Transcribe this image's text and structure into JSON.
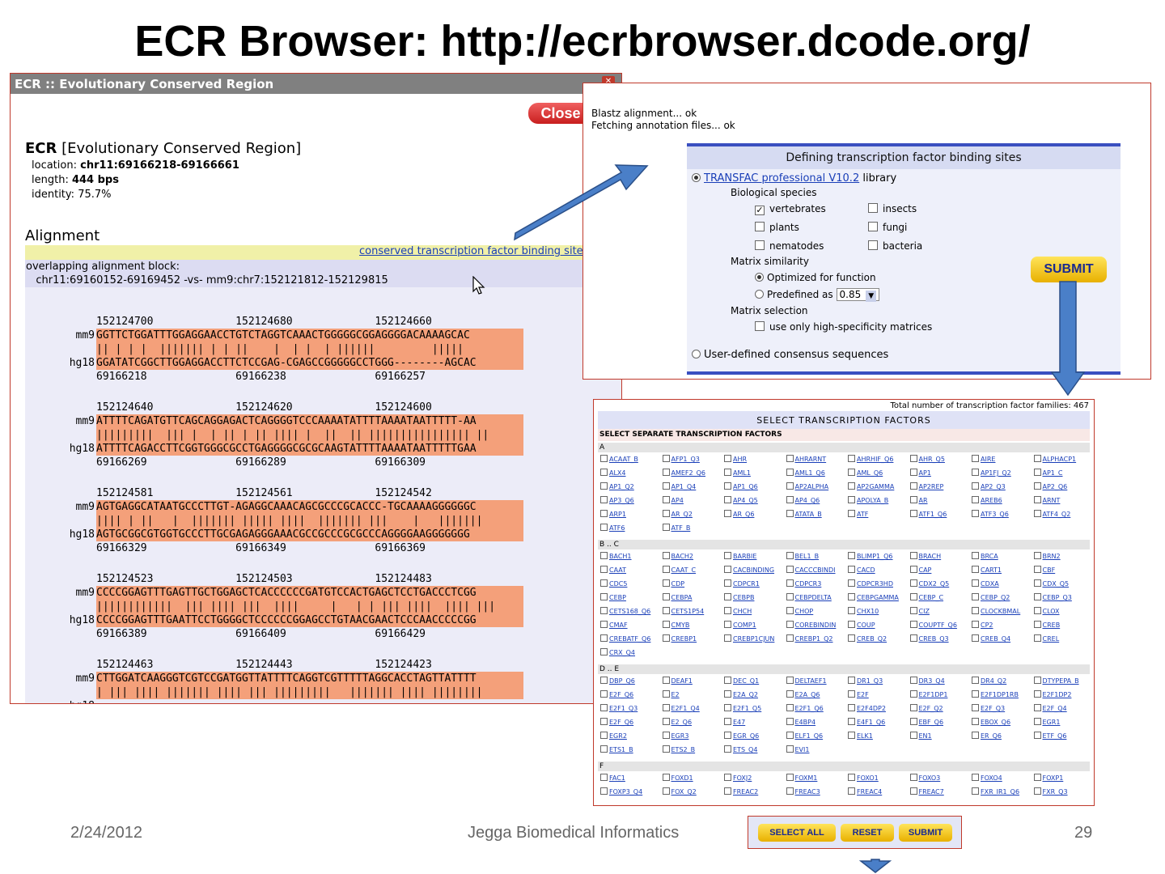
{
  "slide": {
    "title": "ECR Browser: http://ecrbrowser.dcode.org/",
    "date": "2/24/2012",
    "org": "Jegga Biomedical Informatics",
    "page": "29"
  },
  "ecr": {
    "window_title": "ECR :: Evolutionary Conserved Region",
    "close_label": "Close",
    "heading_bold": "ECR",
    "heading_rest": " [Evolutionary Conserved Region]",
    "location_label": "location:",
    "location_value": "chr11:69166218-69166661",
    "length_label": "length:",
    "length_value": "444 bps",
    "identity_label": "identity:",
    "identity_value": "75.7%",
    "alignment_heading": "Alignment",
    "tfbs_link": "conserved transcription factor binding sites (TFBS",
    "overlap_line1": "overlapping alignment block:",
    "overlap_line2": "   chr11:69160152-69169452 -vs- mm9:chr7:152121812-152129815",
    "blocks": [
      {
        "top_coord": "152124700             152124680             152124660",
        "mm9": "GGTTCTGGATTTGGAGGAACCTGTCTAGGTCAAACTGGGGGCGGAGGGGACAAAAGCAC",
        "match": "|| | | |  ||||||| | | ||    |  | |  | ||||||         |||||",
        "hg18": "GGATATCGGCTTGGAGGACCTTCTCCGAG-CGAGCCGGGGGCCTGGG--------AGCAC",
        "bot_coord": "69166218              69166238              69166257"
      },
      {
        "top_coord": "152124640             152124620             152124600",
        "mm9": "ATTTTCAGATGTTCAGCAGGAGACTCAGGGGTCCCAAAATATTTTAAAATAATTTTT-AA",
        "match": "|||||||||  ||| |  | || | || |||| |  ||  || |||||||||||||||| ||",
        "hg18": "ATTTTCAGACCTTCGGTGGGCGCCTGAGGGGCGCGCAAGTATTTTAAAATAATTTTTGAA",
        "bot_coord": "69166269              69166289              69166309"
      },
      {
        "top_coord": "152124581             152124561             152124542",
        "mm9": "AGTGAGGCATAATGCCCTTGT-AGAGGCAAACAGCGCCCGCACCC-TGCAAAAGGGGGGC",
        "match": "|||| | ||   |  ||||||| ||||| ||||  ||||||| |||    |   |||||||",
        "hg18": "AGTGCGGCGTGGTGCCCTTGCGAGAGGGAAACGCCGCCCGCGCCCAGGGGAAGGGGGGG",
        "bot_coord": "69166329              69166349              69166369"
      },
      {
        "top_coord": "152124523             152124503             152124483",
        "mm9": "CCCCGGAGTTTGAGTTGCTGGAGCTCACCCCCCGATGTCCACTGAGCTCCTGACCCTCGG",
        "match": "||||||||||||  ||| |||| |||  ||||     |   | | ||| ||||  |||| |||",
        "hg18": "CCCCGGAGTTTGAATTCCTGGGGCTCCCCCCGGAGCCTGTAACGAACTCCCAACCCCCGG",
        "bot_coord": "69166389              69166409              69166429"
      },
      {
        "top_coord": "152124463             152124443             152124423",
        "mm9": "CTTGGATCAAGGGTCGTCCGATGGTTATTTTCAGGTCGTTTTTAGGCACCTAGTTATTTT",
        "match": "| ||| |||| ||||||| |||| ||| |||||||||   ||||||| |||| ||||||||",
        "hg18": "",
        "bot_coord": ""
      }
    ]
  },
  "popup": {
    "status1": "Blastz alignment... ok",
    "status2": "Fetching annotation files... ok",
    "panel_title": "Defining transcription factor binding sites",
    "transfac_link": "TRANSFAC professional V10.2",
    "transfac_rest": " library",
    "bio_species": "Biological species",
    "species": [
      "vertebrates",
      "insects",
      "plants",
      "fungi",
      "nematodes",
      "bacteria"
    ],
    "matrix_similarity": "Matrix similarity",
    "optimized": "Optimized for function",
    "predefined": "Predefined as",
    "predefined_value": "0.85",
    "matrix_selection": "Matrix selection",
    "high_spec": "use only high-specificity matrices",
    "user_defined": "User-defined consensus sequences",
    "submit_label": "SUBMIT"
  },
  "tfsel": {
    "total": "Total number of transcription factor families: 467",
    "header": "SELECT TRANSCRIPTION FACTORS",
    "subheader": "SELECT SEPARATE TRANSCRIPTION FACTORS",
    "sections": [
      {
        "label": "A",
        "items": [
          "ACAAT_B",
          "AFP1_Q3",
          "AHR",
          "AHRARNT",
          "AHRHIF_Q6",
          "AHR_Q5",
          "AIRE",
          "ALPHACP1",
          "ALX4",
          "AMEF2_Q6",
          "AML1",
          "AML1_Q6",
          "AML_Q6",
          "AP1",
          "AP1FJ_Q2",
          "AP1_C",
          "AP1_Q2",
          "AP1_Q4",
          "AP1_Q6",
          "AP2ALPHA",
          "AP2GAMMA",
          "AP2REP",
          "AP2_Q3",
          "AP2_Q6",
          "AP3_Q6",
          "AP4",
          "AP4_Q5",
          "AP4_Q6",
          "APOLYA_B",
          "AR",
          "AREB6",
          "ARNT",
          "ARP1",
          "AR_Q2",
          "AR_Q6",
          "ATATA_B",
          "ATF",
          "ATF1_Q6",
          "ATF3_Q6",
          "ATF4_Q2",
          "ATF6",
          "ATF_B"
        ]
      },
      {
        "label": "B .. C",
        "items": [
          "BACH1",
          "BACH2",
          "BARBIE",
          "BEL1_B",
          "BLIMP1_Q6",
          "BRACH",
          "BRCA",
          "BRN2",
          "CAAT",
          "CAAT_C",
          "CACBINDING",
          "CACCCBINDI",
          "CACD",
          "CAP",
          "CART1",
          "CBF",
          "CDC5",
          "CDP",
          "CDPCR1",
          "CDPCR3",
          "CDPCR3HD",
          "CDX2_Q5",
          "CDXA",
          "CDX_Q5",
          "CEBP",
          "CEBPA",
          "CEBPB",
          "CEBPDELTA",
          "CEBPGAMMA",
          "CEBP_C",
          "CEBP_Q2",
          "CEBP_Q3",
          "CETS168_Q6",
          "CETS1P54",
          "CHCH",
          "CHOP",
          "CHX10",
          "CIZ",
          "CLOCKBMAL",
          "CLOX",
          "CMAF",
          "CMYB",
          "COMP1",
          "COREBINDIN",
          "COUP",
          "COUPTF_Q6",
          "CP2",
          "CREB",
          "CREBATF_Q6",
          "CREBP1",
          "CREBP1CJUN",
          "CREBP1_Q2",
          "CREB_Q2",
          "CREB_Q3",
          "CREB_Q4",
          "CREL",
          "CRX_Q4"
        ]
      },
      {
        "label": "D .. E",
        "items": [
          "DBP_Q6",
          "DEAF1",
          "DEC_Q1",
          "DELTAEF1",
          "DR1_Q3",
          "DR3_Q4",
          "DR4_Q2",
          "DTYPEPA_B",
          "E2F_Q6",
          "E2",
          "E2A_Q2",
          "E2A_Q6",
          "E2F",
          "E2F1DP1",
          "E2F1DP1RB",
          "E2F1DP2",
          "E2F1_Q3",
          "E2F1_Q4",
          "E2F1_Q5",
          "E2F1_Q6",
          "E2F4DP2",
          "E2F_Q2",
          "E2F_Q3",
          "E2F_Q4",
          "E2F_Q6",
          "E2_Q6",
          "E47",
          "E4BP4",
          "E4F1_Q6",
          "EBF_Q6",
          "EBOX_Q6",
          "EGR1",
          "EGR2",
          "EGR3",
          "EGR_Q6",
          "ELF1_Q6",
          "ELK1",
          "EN1",
          "ER_Q6",
          "ETF_Q6",
          "ETS1_B",
          "ETS2_B",
          "ETS_Q4",
          "EVI1"
        ]
      },
      {
        "label": "F",
        "items": [
          "FAC1",
          "FOXD1",
          "FOXJ2",
          "FOXM1",
          "FOXO1",
          "FOXO3",
          "FOXO4",
          "FOXP1",
          "FOXP3_Q4",
          "FOX_Q2",
          "FREAC2",
          "FREAC3",
          "FREAC4",
          "FREAC7",
          "FXR_IR1_Q6",
          "FXR_Q3"
        ]
      }
    ]
  },
  "buttons": {
    "select_all": "SELECT ALL",
    "reset": "RESET",
    "submit": "SUBMIT"
  },
  "colors": {
    "seq_highlight": "#f4a07a",
    "arrow_fill": "#4a7fc8",
    "frame_red": "#c0392b",
    "button_yellow": "#f5c518"
  },
  "icons": {
    "cursor": "mouse-pointer-icon",
    "window_close": "close-x-icon"
  }
}
